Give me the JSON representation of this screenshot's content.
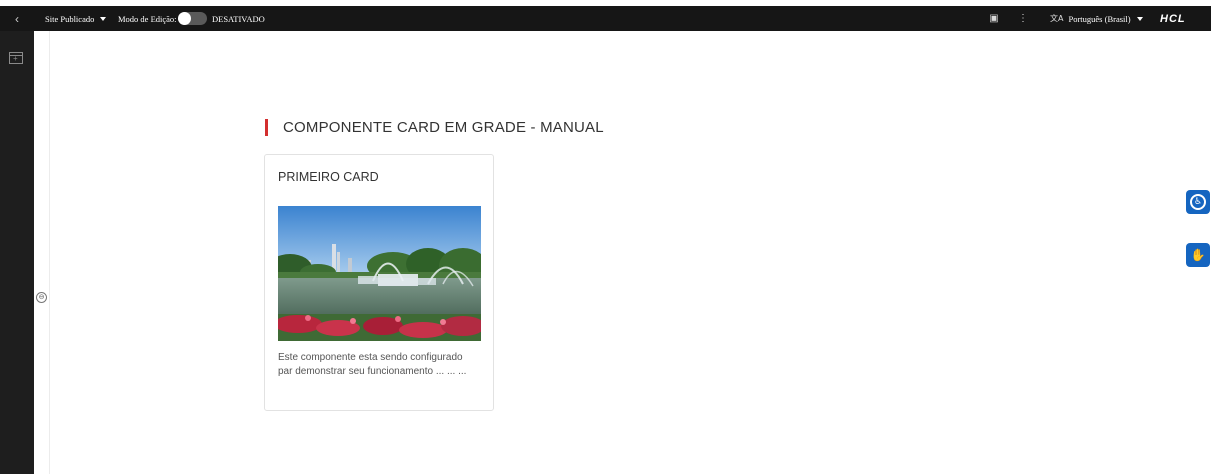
{
  "topbar": {
    "back_icon": "‹",
    "site_status": "Site Publicado",
    "edit_mode_label": "Modo de Edição:",
    "edit_mode_state": "DESATIVADO",
    "panel_icon": "▣",
    "more_icon": "⋮",
    "language": "Português (Brasil)",
    "translate_icon": "文A",
    "brand": "HCL"
  },
  "sidebar": {
    "add_icon": "add-panel-icon",
    "expand_icon": "⊖"
  },
  "content": {
    "section_title": "COMPONENTE CARD EM GRADE - MANUAL",
    "card": {
      "title": "PRIMEIRO CARD",
      "description": "Este componente esta sendo configurado par demonstrar seu funcionamento ... ... ..."
    }
  },
  "accessibility": {
    "a11y_icon": "♿",
    "sign_icon": "✋"
  },
  "colors": {
    "topbar_bg": "#161616",
    "accent_red": "#d32f2f",
    "accessibility_blue": "#1565c0"
  }
}
